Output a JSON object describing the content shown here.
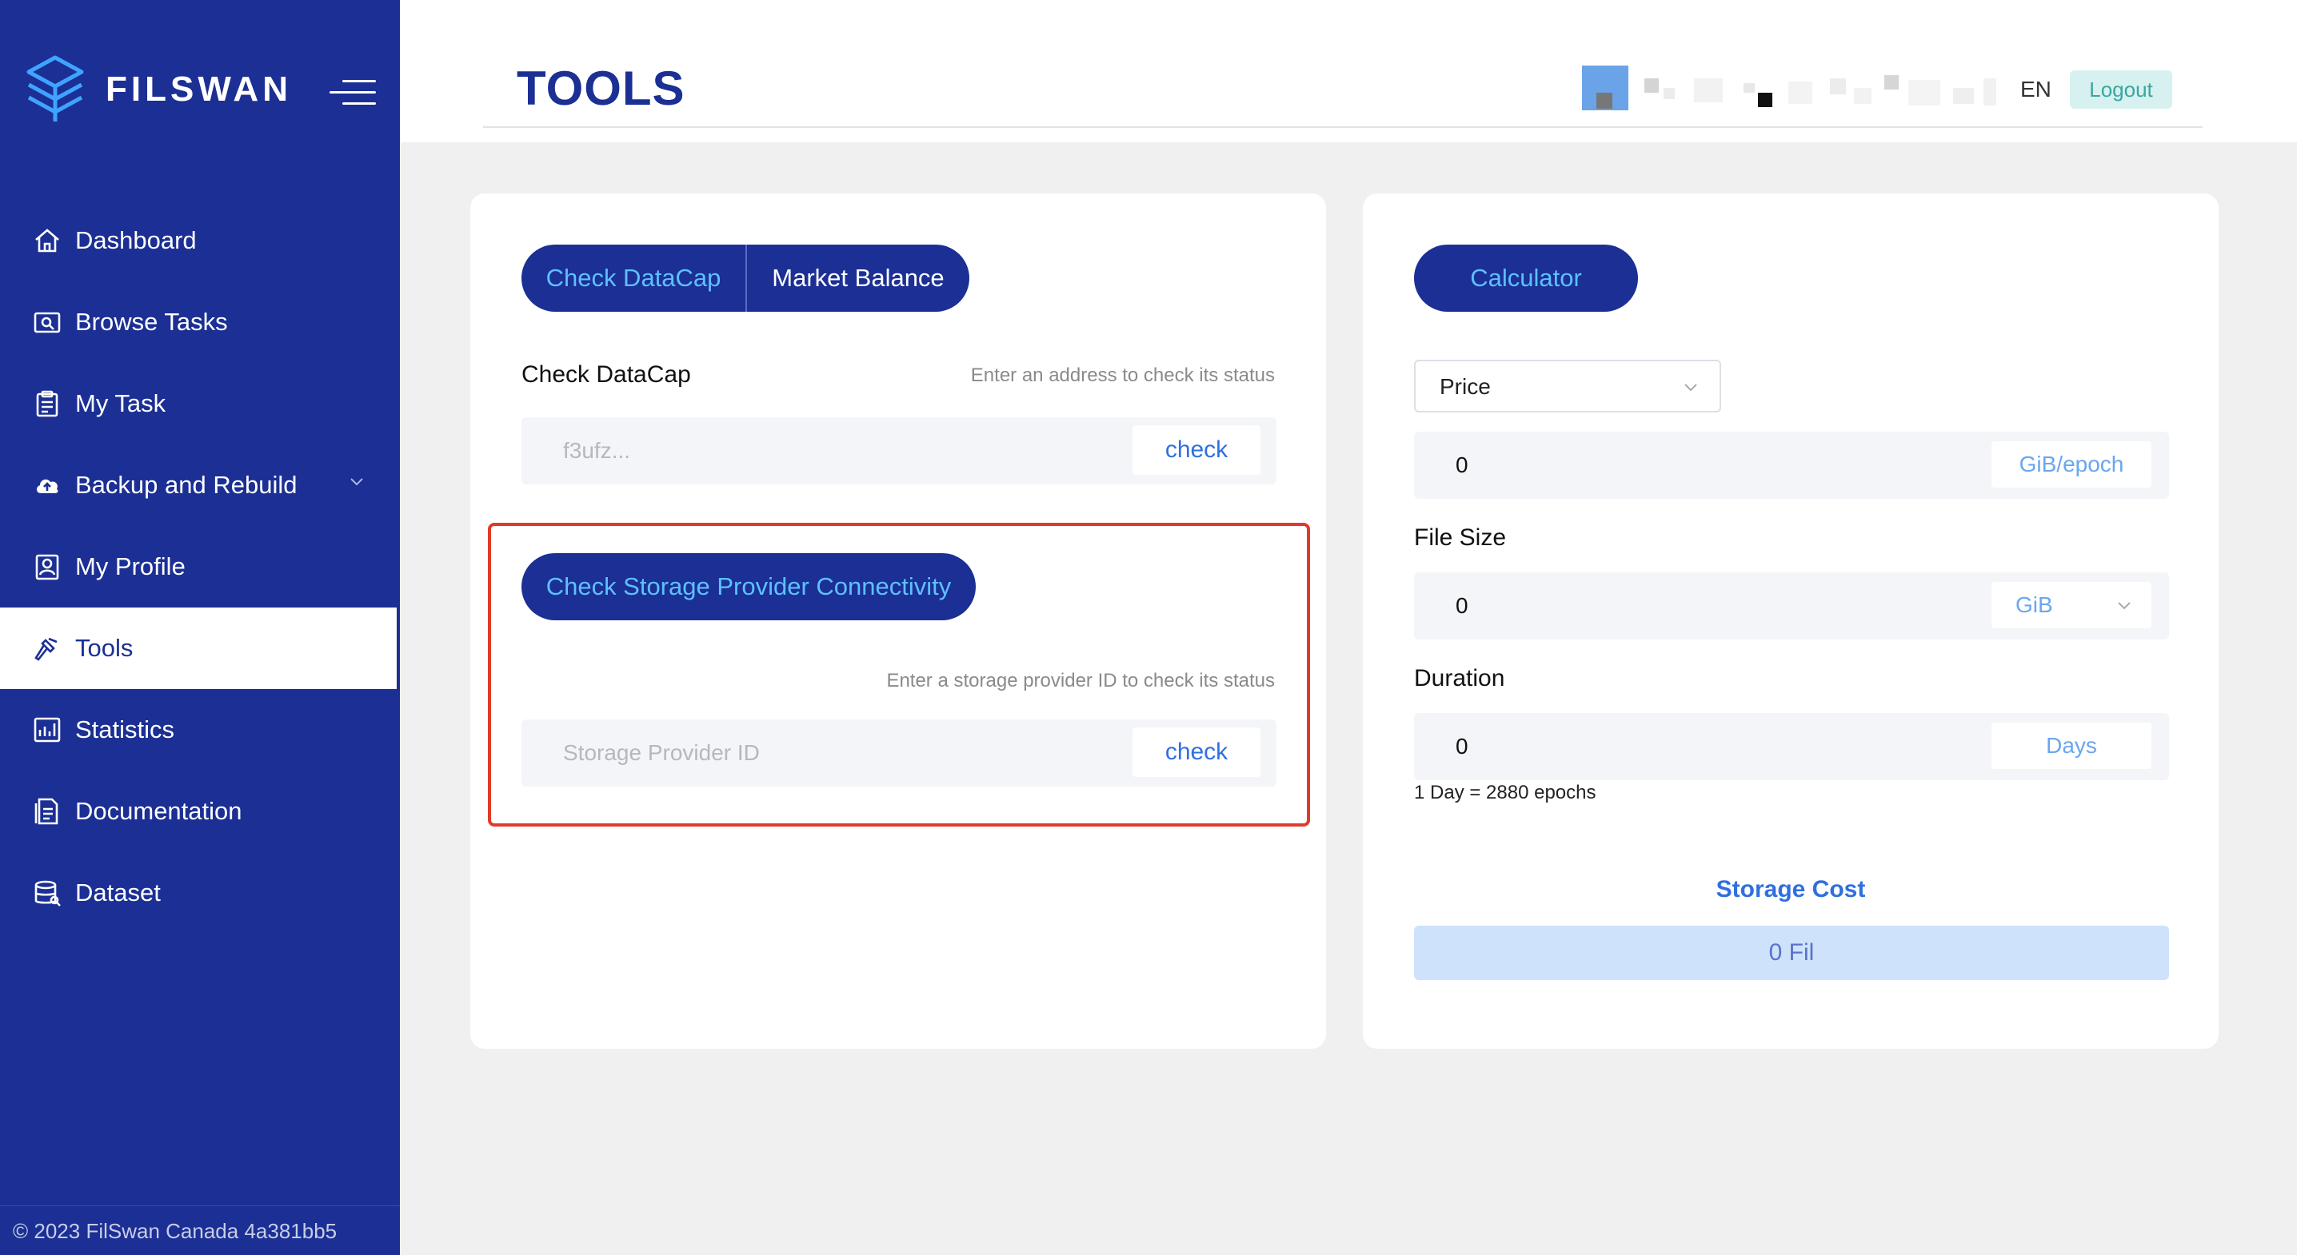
{
  "brand": {
    "name": "FILSWAN"
  },
  "sidebar": {
    "items": [
      {
        "label": "Dashboard",
        "icon": "home-icon"
      },
      {
        "label": "Browse Tasks",
        "icon": "browse-icon"
      },
      {
        "label": "My Task",
        "icon": "clipboard-icon"
      },
      {
        "label": "Backup and Rebuild",
        "icon": "cloud-upload-icon"
      },
      {
        "label": "My Profile",
        "icon": "profile-icon"
      },
      {
        "label": "Tools",
        "icon": "hammer-icon",
        "active": true
      },
      {
        "label": "Statistics",
        "icon": "chart-icon"
      },
      {
        "label": "Documentation",
        "icon": "document-icon"
      },
      {
        "label": "Dataset",
        "icon": "database-icon"
      }
    ],
    "footer": "© 2023 FilSwan Canada 4a381bb5"
  },
  "header": {
    "title": "TOOLS",
    "language": "EN",
    "logout_label": "Logout"
  },
  "left_card": {
    "tabs": [
      "Check DataCap",
      "Market Balance"
    ],
    "datacap": {
      "label": "Check DataCap",
      "hint": "Enter an address to check its status",
      "placeholder": "f3ufz...",
      "button": "check"
    },
    "connectivity": {
      "button": "Check Storage Provider Connectivity",
      "hint": "Enter a storage provider ID to check its status",
      "placeholder": "Storage Provider ID",
      "button_check": "check"
    }
  },
  "calculator": {
    "title": "Calculator",
    "price_select": "Price",
    "price_value": "0",
    "price_unit": "GiB/epoch",
    "file_size_label": "File Size",
    "file_size_value": "0",
    "file_size_unit": "GiB",
    "duration_label": "Duration",
    "duration_value": "0",
    "duration_unit": "Days",
    "duration_note": "1 Day = 2880 epochs",
    "storage_cost_label": "Storage Cost",
    "storage_cost_value": "0 Fil"
  },
  "colors": {
    "sidebar": "#1b2f94",
    "accent_text": "#5ec0ff",
    "highlight_border": "#e23a2a",
    "cost_bg": "#cfe2fb"
  }
}
